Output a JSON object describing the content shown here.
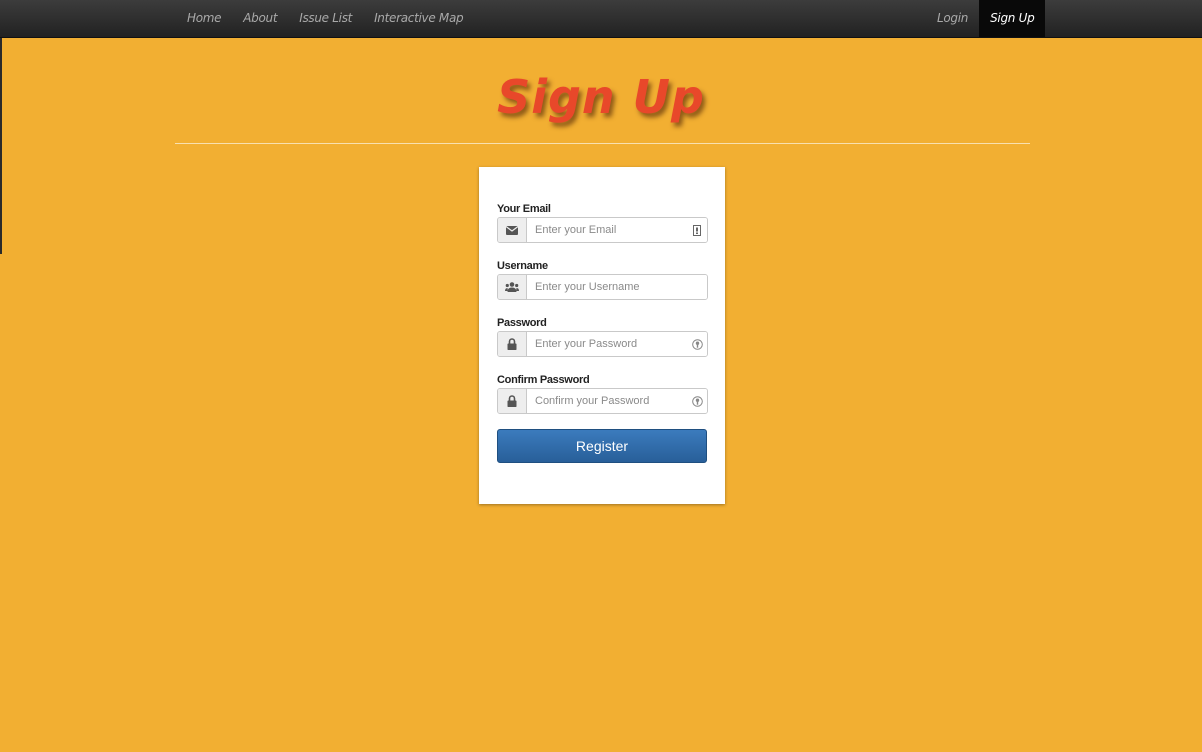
{
  "nav": {
    "left_items": [
      {
        "label": "Home"
      },
      {
        "label": "About"
      },
      {
        "label": "Issue List"
      },
      {
        "label": "Interactive Map"
      }
    ],
    "right_items": [
      {
        "label": "Login"
      },
      {
        "label": "Sign Up",
        "active": true
      }
    ]
  },
  "page": {
    "title": "Sign Up"
  },
  "form": {
    "email": {
      "label": "Your Email",
      "placeholder": "Enter your Email",
      "value": "",
      "icon": "envelope-icon"
    },
    "username": {
      "label": "Username",
      "placeholder": "Enter your Username",
      "value": "",
      "icon": "users-icon"
    },
    "password": {
      "label": "Password",
      "placeholder": "Enter your Password",
      "value": "",
      "icon": "lock-icon"
    },
    "confirm_password": {
      "label": "Confirm Password",
      "placeholder": "Confirm your Password",
      "value": "",
      "icon": "lock-icon"
    },
    "submit_label": "Register"
  },
  "colors": {
    "background": "#f2af32",
    "title": "#e8482a",
    "navbar": "#2d2d2d",
    "nav_active": "#090909",
    "button": "#337ab7"
  }
}
